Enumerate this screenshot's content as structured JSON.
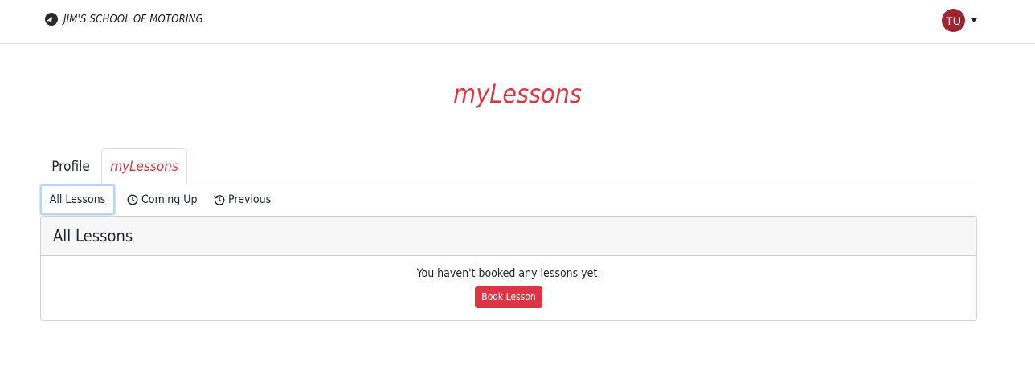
{
  "navbar": {
    "brand_text": "JIM'S SCHOOL OF MOTORING",
    "brand_icon": "helmet-logo-icon",
    "user_initials": "TU",
    "user_menu_icon": "caret-down-icon"
  },
  "page": {
    "title": "myLessons"
  },
  "main_tabs": [
    {
      "label": "Profile",
      "active": false
    },
    {
      "label": "myLessons",
      "active": true
    }
  ],
  "sub_tabs": [
    {
      "label": "All Lessons",
      "icon": null,
      "active": true
    },
    {
      "label": "Coming Up",
      "icon": "clock-icon",
      "active": false
    },
    {
      "label": "Previous",
      "icon": "history-icon",
      "active": false
    }
  ],
  "card": {
    "header": "All Lessons",
    "empty_message": "You haven't booked any lessons yet.",
    "book_button_label": "Book Lesson"
  },
  "colors": {
    "accent": "#dc3545",
    "avatar_bg": "#9e2533",
    "focus_ring": "#b9d4fb"
  }
}
